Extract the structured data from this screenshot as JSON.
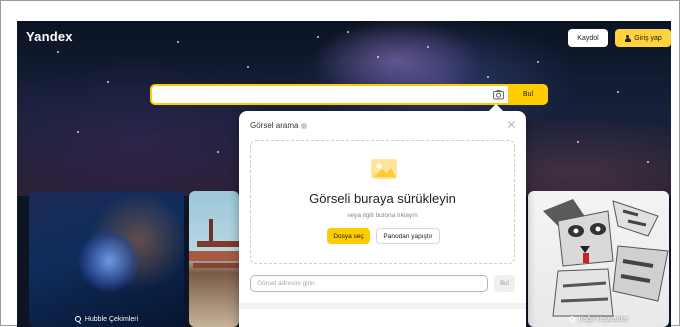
{
  "header": {
    "logo": "Yandex",
    "register_label": "Kaydol",
    "login_label": "Giriş yap"
  },
  "search": {
    "button_label": "Bul",
    "value": ""
  },
  "cards": [
    {
      "label": "Hubble Çekimleri"
    },
    {
      "label": "Kağıt Hayvanlar"
    }
  ],
  "popup": {
    "title": "Görsel arama",
    "drop_title": "Görseli buraya sürükleyin",
    "drop_subtitle": "veya ilgili butona tıklayın",
    "file_button": "Dosya seç",
    "paste_button": "Panodan yapıştır",
    "url_placeholder": "Görsel adresini girin",
    "url_button": "Bul"
  },
  "colors": {
    "accent": "#ffcc00",
    "login_bg": "#ffd33d"
  }
}
